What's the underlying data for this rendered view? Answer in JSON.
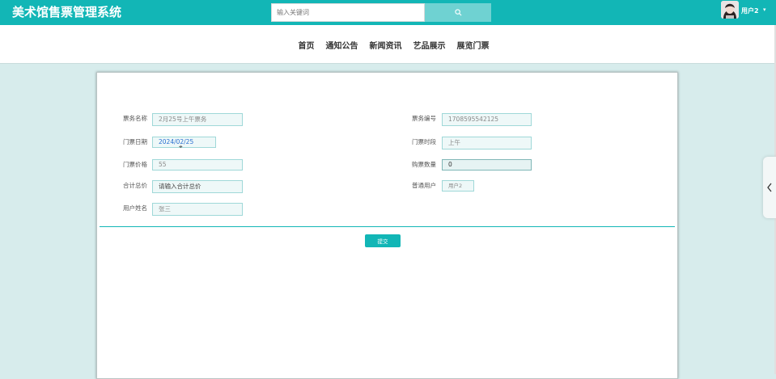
{
  "header": {
    "app_title": "美术馆售票管理系统",
    "search": {
      "placeholder": "输入关键词",
      "button_icon": "search-icon"
    },
    "user": {
      "name": "用户2",
      "avatar_icon": "avatar-image",
      "menu_icon": "caret-down-icon"
    }
  },
  "nav": {
    "items": [
      "首页",
      "通知公告",
      "新闻资讯",
      "艺品展示",
      "展览门票"
    ]
  },
  "form": {
    "fields": {
      "ticket_name": {
        "label": "票务名称",
        "value": "2月25号上午票务"
      },
      "ticket_no": {
        "label": "票务编号",
        "value": "1708595542125"
      },
      "ticket_date": {
        "label": "门票日期",
        "value": "2024/02/25"
      },
      "time_slot": {
        "label": "门票时段",
        "value": "上午"
      },
      "price": {
        "label": "门票价格",
        "value": "55"
      },
      "quantity": {
        "label": "购票数量",
        "value": "0"
      },
      "total": {
        "label": "合计总价",
        "placeholder": "请输入合计总价"
      },
      "account": {
        "label": "普通用户",
        "value": "用户2"
      },
      "real_name": {
        "label": "用户姓名",
        "value": "张三"
      }
    },
    "submit_label": "提交"
  },
  "side_tab": {
    "icon": "chevron-left-icon"
  },
  "colors": {
    "accent": "#12b6b6",
    "page_bg": "#d7ecec",
    "input_border": "#9fd8d8"
  }
}
